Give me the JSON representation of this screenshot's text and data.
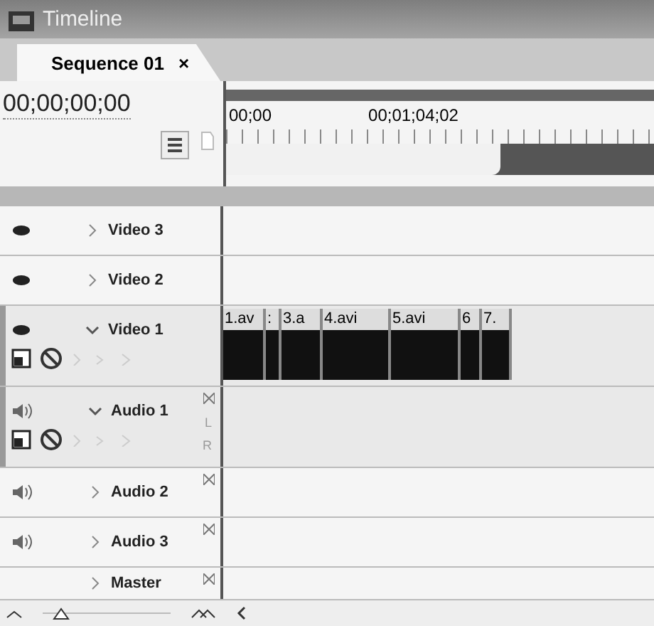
{
  "window": {
    "title": "Timeline"
  },
  "tabs": [
    {
      "label": "Sequence 01",
      "close": "×",
      "selected": true
    }
  ],
  "timecode": "00;00;00;00",
  "ruler": {
    "labels": [
      "00;00",
      "00;01;04;02"
    ],
    "work_area": {
      "level": 0.64
    }
  },
  "tracks": [
    {
      "name": "Video 3",
      "kind": "video",
      "expanded": false
    },
    {
      "name": "Video 2",
      "kind": "video",
      "expanded": false
    },
    {
      "name": "Video 1",
      "kind": "video",
      "expanded": true,
      "clips": [
        "1.av",
        ":",
        "3.a",
        "4.avi",
        "5.avi",
        "6",
        "7."
      ]
    },
    {
      "name": "Audio 1",
      "kind": "audio",
      "expanded": true,
      "channels": [
        "L",
        "R"
      ]
    },
    {
      "name": "Audio 2",
      "kind": "audio",
      "expanded": false
    },
    {
      "name": "Audio 3",
      "kind": "audio",
      "expanded": false
    },
    {
      "name": "Master",
      "kind": "master",
      "expanded": false
    }
  ]
}
